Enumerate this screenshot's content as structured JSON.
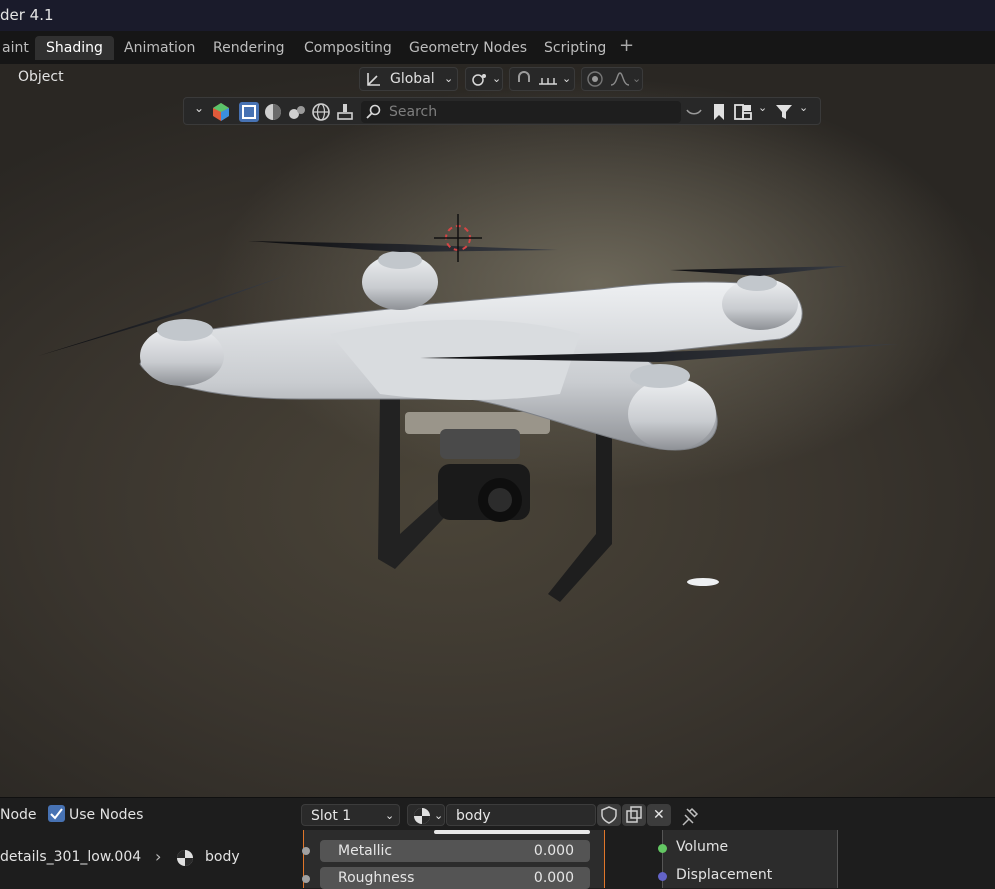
{
  "app": {
    "title": "der 4.1"
  },
  "workspaces": {
    "tabs": [
      "aint",
      "Shading",
      "Animation",
      "Rendering",
      "Compositing",
      "Geometry Nodes",
      "Scripting"
    ],
    "active": "Shading",
    "add_label": "+"
  },
  "viewport_header": {
    "object_menu": "Object",
    "transform_orientation": "Global",
    "search_placeholder": "Search"
  },
  "node_header": {
    "node_label": "Node",
    "use_nodes_label": "Use Nodes",
    "use_nodes_checked": true,
    "slot": "Slot 1",
    "material": "body"
  },
  "breadcrumb": {
    "object": "details_301_low.004",
    "material": "body"
  },
  "inputs": [
    {
      "label": "Metallic",
      "value": "0.000"
    },
    {
      "label": "Roughness",
      "value": "0.000"
    }
  ],
  "outputs": [
    {
      "label": "Volume",
      "color": "#63c763"
    },
    {
      "label": "Displacement",
      "color": "#6363c7"
    }
  ],
  "colors": {
    "accent": "#4772b3",
    "cursor": "#d64545"
  }
}
